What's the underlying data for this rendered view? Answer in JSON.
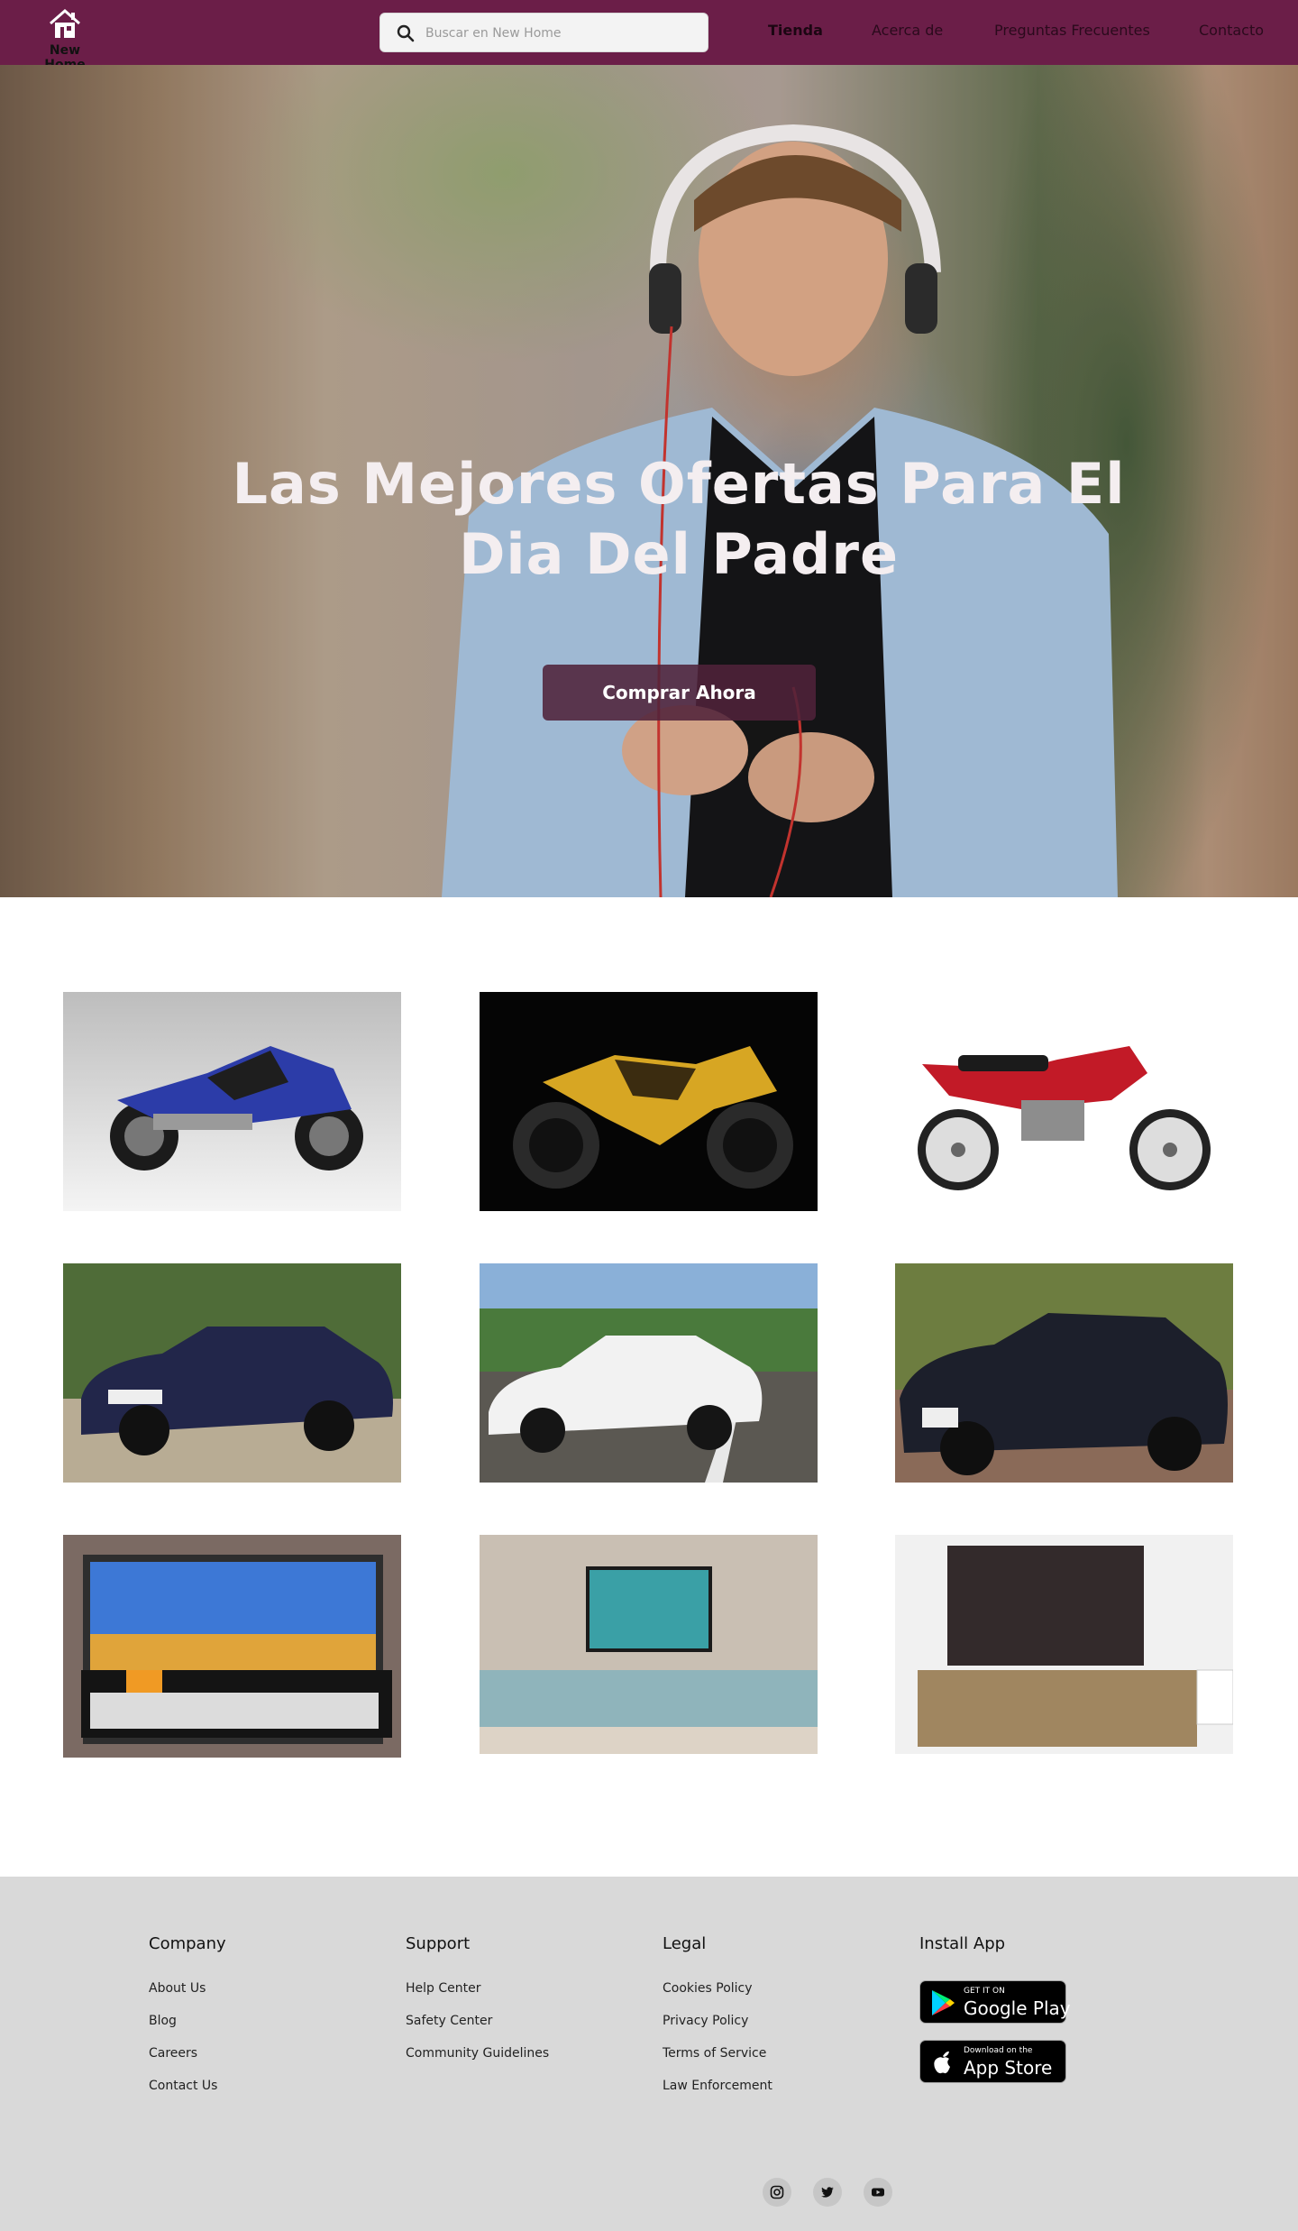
{
  "nav": {
    "brand": "New Home",
    "search_placeholder": "Buscar en New Home",
    "links": [
      "Tienda",
      "Acerca de",
      "Preguntas Frecuentes",
      "Contacto"
    ],
    "color": "#6b1e48"
  },
  "hero": {
    "title_line1": "Las Mejores Ofertas Para El",
    "title_line2": "Dia Del Padre",
    "button_label": "Comprar Ahora"
  },
  "products": [
    {
      "icon": "sport-motorcycle-blue"
    },
    {
      "icon": "motorcycle-yellow"
    },
    {
      "icon": "motorcycle-red"
    },
    {
      "icon": "sedan-dark-blue"
    },
    {
      "icon": "sedan-white"
    },
    {
      "icon": "sedan-black"
    },
    {
      "icon": "tv-lg-smart"
    },
    {
      "icon": "tv-landscape-stand"
    },
    {
      "icon": "tv-dark-console"
    }
  ],
  "footer": {
    "columns": [
      {
        "title": "Company",
        "links": [
          "About Us",
          "Blog",
          "Careers",
          "Contact Us"
        ]
      },
      {
        "title": "Support",
        "links": [
          "Help Center",
          "Safety Center",
          "Community Guidelines"
        ]
      },
      {
        "title": "Legal",
        "links": [
          "Cookies Policy",
          "Privacy Policy",
          "Terms of Service",
          "Law Enforcement"
        ]
      },
      {
        "title": "Install App"
      }
    ],
    "google_play": {
      "small": "GET IT ON",
      "big": "Google Play"
    },
    "app_store": {
      "small": "Download on the",
      "big": "App Store"
    },
    "social": [
      "instagram-icon",
      "twitter-icon",
      "youtube-icon"
    ]
  }
}
